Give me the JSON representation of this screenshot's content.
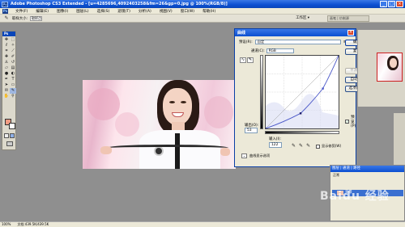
{
  "window": {
    "title": "Adobe Photoshop CS3 Extended - [u=4285696,4092403258&fm=26&gp=0.jpg @ 100%(RGB/8)]",
    "app_logo": "Ps"
  },
  "menu": [
    "文件(F)",
    "编辑(E)",
    "图像(I)",
    "图层(L)",
    "选择(S)",
    "滤镜(T)",
    "分析(A)",
    "视图(V)",
    "窗口(W)",
    "帮助(H)"
  ],
  "options_bar": {
    "label": "取样大小:",
    "value": "取样点",
    "workspace": "工作区 ▾",
    "brushes_tab": "画笔 | 仿制源"
  },
  "toolbox": {
    "header": "Ps",
    "tools": [
      "move-icon",
      "marquee-icon",
      "lasso-icon",
      "magic-wand-icon",
      "crop-icon",
      "slice-icon",
      "healing-icon",
      "brush-icon",
      "stamp-icon",
      "history-brush-icon",
      "eraser-icon",
      "gradient-icon",
      "blur-icon",
      "dodge-icon",
      "pen-icon",
      "type-icon",
      "path-select-icon",
      "shape-icon",
      "notes-icon",
      "eyedropper-icon",
      "hand-icon",
      "zoom-icon"
    ],
    "foreground_color": "#f29c83",
    "background_color": "#ffffff"
  },
  "curves_dialog": {
    "title": "曲线",
    "preset_label": "预设(R):",
    "preset_value": "自定",
    "channel_label": "通道(C):",
    "channel_value": "RGB",
    "output_label": "输出(O):",
    "output_value": "53",
    "input_label": "输入(I):",
    "input_value": "122",
    "show_clipping": "显示修剪(W)",
    "curve_display_options": "曲线显示选项",
    "buttons": {
      "ok": "确定",
      "reset": "复位",
      "smooth": "平滑(M)",
      "auto": "自动(A)",
      "options": "选项(T)..."
    },
    "preview_label": "预览(P)",
    "preview_checked": true,
    "curve": {
      "points": [
        [
          0,
          0
        ],
        [
          122,
          53
        ],
        [
          200,
          140
        ],
        [
          255,
          255
        ]
      ]
    }
  },
  "layers_panel": {
    "tabs": "图层 | 通道 | 路径",
    "mode": "正常",
    "layer_name": "背景"
  },
  "status": {
    "zoom": "100%",
    "doc": "文档:439.5K/439.5K"
  },
  "watermark": "Baidu 经验"
}
